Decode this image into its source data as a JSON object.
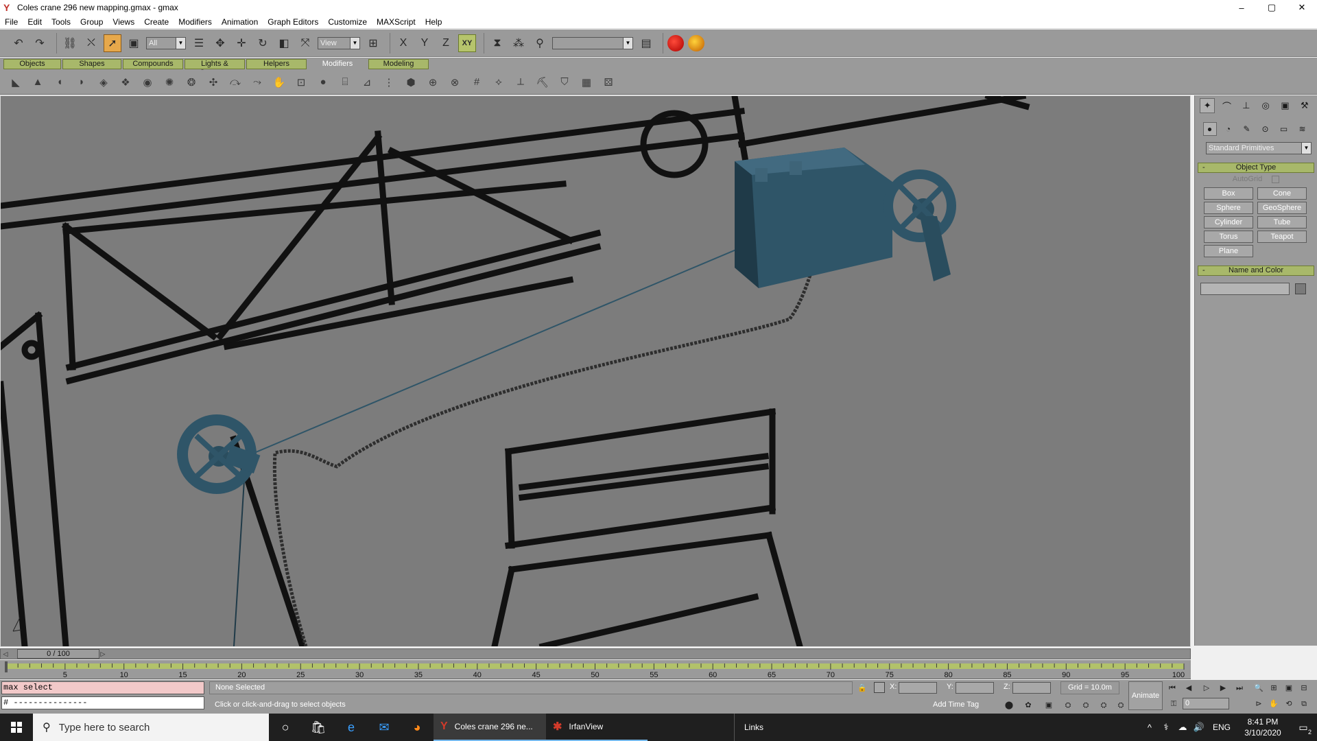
{
  "window": {
    "title": "Coles crane 296 new mapping.gmax - gmax",
    "controls": {
      "minimize": "–",
      "maximize": "▢",
      "close": "✕"
    }
  },
  "menu": [
    "File",
    "Edit",
    "Tools",
    "Group",
    "Views",
    "Create",
    "Modifiers",
    "Animation",
    "Graph Editors",
    "Customize",
    "MAXScript",
    "Help"
  ],
  "toolbar": {
    "selection_filter": "All",
    "reference_coord": "View",
    "named_selection": "",
    "axis_x": "X",
    "axis_y": "Y",
    "axis_z": "Z",
    "axis_xy": "XY"
  },
  "tabs": [
    {
      "label": "Objects",
      "active": false
    },
    {
      "label": "Shapes",
      "active": false
    },
    {
      "label": "Compounds",
      "active": false
    },
    {
      "label": "Lights & Cameras",
      "active": false
    },
    {
      "label": "Helpers",
      "active": false
    },
    {
      "label": "Modifiers",
      "active": true
    },
    {
      "label": "Modeling",
      "active": false
    }
  ],
  "command_panel": {
    "category": "Standard Primitives",
    "object_type": {
      "header": "Object Type",
      "autogrid_label": "AutoGrid",
      "buttons": [
        "Box",
        "Cone",
        "Sphere",
        "GeoSphere",
        "Cylinder",
        "Tube",
        "Torus",
        "Teapot",
        "Plane"
      ]
    },
    "name_and_color": {
      "header": "Name and Color",
      "name_value": ""
    }
  },
  "timeline": {
    "position": "0 / 100",
    "ticks": [
      "5",
      "10",
      "15",
      "20",
      "25",
      "30",
      "35",
      "40",
      "45",
      "50",
      "55",
      "60",
      "65",
      "70",
      "75",
      "80",
      "85",
      "90",
      "95",
      "100"
    ]
  },
  "status": {
    "listener_line1": "max select",
    "listener_line2": "# ---------------",
    "selection": "None Selected",
    "prompt": "Click or click-and-drag to select objects",
    "x_label": "X:",
    "y_label": "Y:",
    "z_label": "Z:",
    "grid": "Grid = 10.0m",
    "add_time_tag": "Add Time Tag",
    "animate": "Animate",
    "frame": "0"
  },
  "taskbar": {
    "search_placeholder": "Type here to search",
    "apps": [
      {
        "label": "Coles crane 296 ne...",
        "active": true
      },
      {
        "label": "IrfanView",
        "active": false
      }
    ],
    "links": "Links",
    "language": "ENG",
    "time": "8:41 PM",
    "date": "3/10/2020",
    "notifications": "2"
  },
  "colors": {
    "viewport_bg": "#7c7c7c",
    "ui_gray": "#9a9a9a",
    "tab_green": "#a8b86a",
    "model_blue": "#2f5568",
    "active_tool": "#e6a84b"
  }
}
